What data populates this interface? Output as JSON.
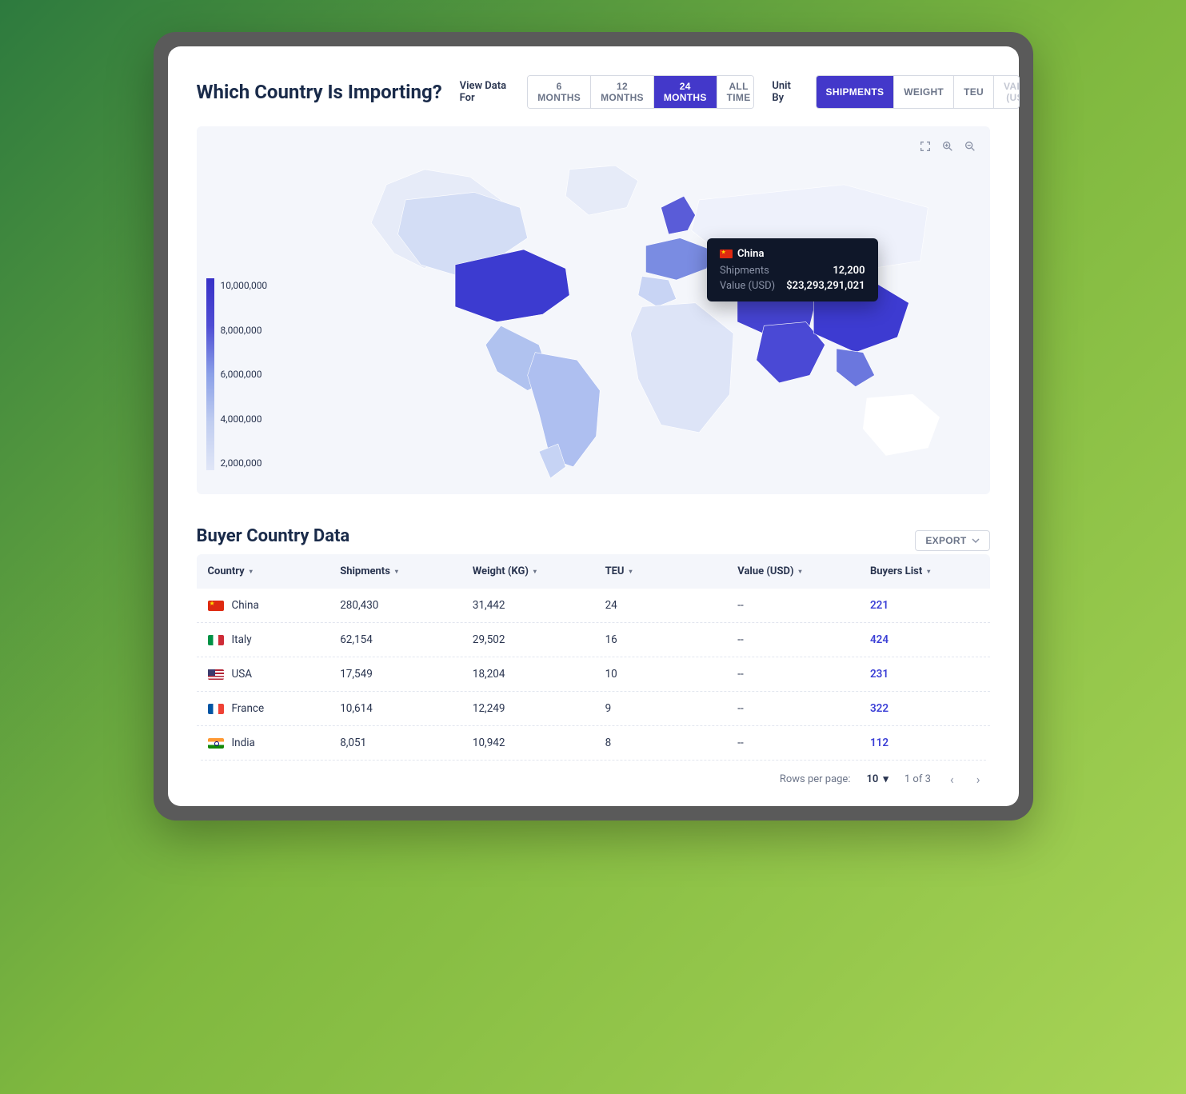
{
  "header": {
    "title": "Which Country Is Importing?",
    "view_label": "View Data For",
    "view_opts": [
      "6 MONTHS",
      "12 MONTHS",
      "24 MONTHS",
      "ALL TIME"
    ],
    "view_active": "24 MONTHS",
    "unit_label": "Unit By",
    "unit_opts": [
      "SHIPMENTS",
      "WEIGHT",
      "TEU",
      "VALUE (USD)"
    ],
    "unit_active": "SHIPMENTS",
    "unit_disabled": "VALUE (USD)"
  },
  "map": {
    "legend_ticks": [
      "10,000,000",
      "8,000,000",
      "6,000,000",
      "4,000,000",
      "2,000,000"
    ],
    "tooltip": {
      "country": "China",
      "ship_label": "Shipments",
      "ship_val": "12,200",
      "val_label": "Value (USD)",
      "val_val": "$23,293,291,021"
    }
  },
  "table": {
    "title": "Buyer Country Data",
    "export_label": "EXPORT",
    "columns": [
      "Country",
      "Shipments",
      "Weight (KG)",
      "TEU",
      "Value (USD)",
      "Buyers List"
    ],
    "rows": [
      {
        "flag": "cn",
        "country": "China",
        "shipments": "280,430",
        "weight": "31,442",
        "teu": "24",
        "value": "--",
        "buyers": "221"
      },
      {
        "flag": "it",
        "country": "Italy",
        "shipments": "62,154",
        "weight": "29,502",
        "teu": "16",
        "value": "--",
        "buyers": "424"
      },
      {
        "flag": "us",
        "country": "USA",
        "shipments": "17,549",
        "weight": "18,204",
        "teu": "10",
        "value": "--",
        "buyers": "231"
      },
      {
        "flag": "fr",
        "country": "France",
        "shipments": "10,614",
        "weight": "12,249",
        "teu": "9",
        "value": "--",
        "buyers": "322"
      },
      {
        "flag": "in",
        "country": "India",
        "shipments": "8,051",
        "weight": "10,942",
        "teu": "8",
        "value": "--",
        "buyers": "112"
      }
    ],
    "pager": {
      "rpp_label": "Rows per page:",
      "rpp_val": "10",
      "range": "1 of 3"
    }
  },
  "chart_data": {
    "type": "heatmap",
    "title": "Which Country Is Importing?",
    "metric": "Shipments",
    "color_scale": {
      "min": 2000000,
      "max": 10000000,
      "ticks": [
        10000000,
        8000000,
        6000000,
        4000000,
        2000000
      ]
    },
    "tooltip_sample": {
      "country": "China",
      "shipments": 12200,
      "value_usd": 23293291021
    },
    "tabular_excerpt": [
      {
        "country": "China",
        "shipments": 280430,
        "weight_kg": 31442,
        "teu": 24,
        "value_usd": null,
        "buyers": 221
      },
      {
        "country": "Italy",
        "shipments": 62154,
        "weight_kg": 29502,
        "teu": 16,
        "value_usd": null,
        "buyers": 424
      },
      {
        "country": "USA",
        "shipments": 17549,
        "weight_kg": 18204,
        "teu": 10,
        "value_usd": null,
        "buyers": 231
      },
      {
        "country": "France",
        "shipments": 10614,
        "weight_kg": 12249,
        "teu": 9,
        "value_usd": null,
        "buyers": 322
      },
      {
        "country": "India",
        "shipments": 8051,
        "weight_kg": 10942,
        "teu": 8,
        "value_usd": null,
        "buyers": 112
      }
    ]
  }
}
